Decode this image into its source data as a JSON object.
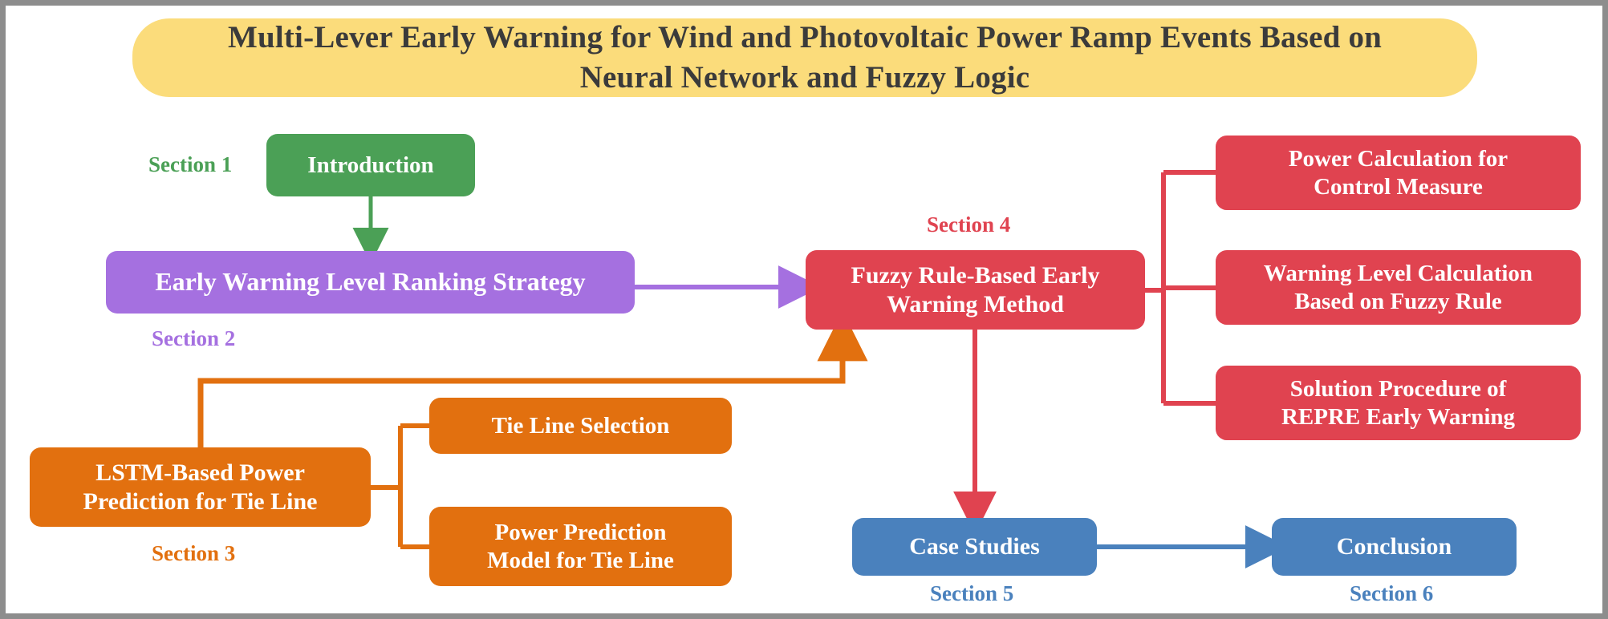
{
  "title": {
    "line1": "Multi-Lever Early Warning for Wind and Photovoltaic Power Ramp Events Based on",
    "line2": "Neural Network and Fuzzy Logic",
    "background": "#fbdc7b",
    "text_color": "#3b3b3b"
  },
  "nodes": {
    "introduction": {
      "label": "Introduction",
      "color": "#4ba056"
    },
    "early_warning_level_ranking_strategy": {
      "label": "Early Warning Level Ranking Strategy",
      "color": "#a570e0"
    },
    "lstm_based_power_prediction": {
      "line1": "LSTM-Based Power",
      "line2": "Prediction for Tie Line",
      "color": "#e2700f"
    },
    "tie_line_selection": {
      "label": "Tie Line Selection",
      "color": "#e2700f"
    },
    "power_prediction_model": {
      "line1": "Power Prediction",
      "line2": "Model for Tie Line",
      "color": "#e2700f"
    },
    "fuzzy_rule_based_early_warning_method": {
      "line1": "Fuzzy Rule-Based Early",
      "line2": "Warning Method",
      "color": "#e04350"
    },
    "power_calculation_for_control_measure": {
      "line1": "Power Calculation for",
      "line2": "Control Measure",
      "color": "#e04350"
    },
    "warning_level_calculation": {
      "line1": "Warning Level Calculation",
      "line2": "Based on Fuzzy Rule",
      "color": "#e04350"
    },
    "solution_procedure_repre": {
      "line1": "Solution Procedure of",
      "line2": "REPRE Early Warning",
      "color": "#e04350"
    },
    "case_studies": {
      "label": "Case Studies",
      "color": "#4a81bd"
    },
    "conclusion": {
      "label": "Conclusion",
      "color": "#4a81bd"
    }
  },
  "section_labels": {
    "section1": "Section 1",
    "section2": "Section 2",
    "section3": "Section 3",
    "section4": "Section 4",
    "section5": "Section 5",
    "section6": "Section 6"
  },
  "chart_data": {
    "type": "diagram",
    "title": "Multi-Lever Early Warning for Wind and Photovoltaic Power Ramp Events Based on Neural Network and Fuzzy Logic",
    "diagram_kind": "flowchart",
    "nodes": [
      {
        "id": "introduction",
        "label": "Introduction",
        "section": "Section 1",
        "color": "#4ba056"
      },
      {
        "id": "early_warning_level_ranking_strategy",
        "label": "Early Warning Level Ranking Strategy",
        "section": "Section 2",
        "color": "#a570e0"
      },
      {
        "id": "lstm_based_power_prediction",
        "label": "LSTM-Based Power Prediction for Tie Line",
        "section": "Section 3",
        "color": "#e2700f"
      },
      {
        "id": "tie_line_selection",
        "label": "Tie Line Selection",
        "section": "Section 3",
        "color": "#e2700f"
      },
      {
        "id": "power_prediction_model",
        "label": "Power Prediction Model for Tie Line",
        "section": "Section 3",
        "color": "#e2700f"
      },
      {
        "id": "fuzzy_rule_based_early_warning_method",
        "label": "Fuzzy Rule-Based Early Warning Method",
        "section": "Section 4",
        "color": "#e04350"
      },
      {
        "id": "power_calculation_for_control_measure",
        "label": "Power Calculation for Control Measure",
        "section": "Section 4",
        "color": "#e04350"
      },
      {
        "id": "warning_level_calculation",
        "label": "Warning Level Calculation Based on Fuzzy Rule",
        "section": "Section 4",
        "color": "#e04350"
      },
      {
        "id": "solution_procedure_repre",
        "label": "Solution Procedure of REPRE Early Warning",
        "section": "Section 4",
        "color": "#e04350"
      },
      {
        "id": "case_studies",
        "label": "Case Studies",
        "section": "Section 5",
        "color": "#4a81bd"
      },
      {
        "id": "conclusion",
        "label": "Conclusion",
        "section": "Section 6",
        "color": "#4a81bd"
      }
    ],
    "edges": [
      {
        "from": "introduction",
        "to": "early_warning_level_ranking_strategy",
        "style": "arrow",
        "color": "#4ba056"
      },
      {
        "from": "early_warning_level_ranking_strategy",
        "to": "fuzzy_rule_based_early_warning_method",
        "style": "arrow",
        "color": "#a570e0"
      },
      {
        "from": "lstm_based_power_prediction",
        "to": "fuzzy_rule_based_early_warning_method",
        "style": "elbow-arrow",
        "color": "#e2700f"
      },
      {
        "from": "lstm_based_power_prediction",
        "to": "tie_line_selection",
        "style": "bracket",
        "color": "#e2700f"
      },
      {
        "from": "lstm_based_power_prediction",
        "to": "power_prediction_model",
        "style": "bracket",
        "color": "#e2700f"
      },
      {
        "from": "fuzzy_rule_based_early_warning_method",
        "to": "power_calculation_for_control_measure",
        "style": "bracket",
        "color": "#e04350"
      },
      {
        "from": "fuzzy_rule_based_early_warning_method",
        "to": "warning_level_calculation",
        "style": "bracket",
        "color": "#e04350"
      },
      {
        "from": "fuzzy_rule_based_early_warning_method",
        "to": "solution_procedure_repre",
        "style": "bracket",
        "color": "#e04350"
      },
      {
        "from": "fuzzy_rule_based_early_warning_method",
        "to": "case_studies",
        "style": "arrow",
        "color": "#e04350"
      },
      {
        "from": "case_studies",
        "to": "conclusion",
        "style": "arrow",
        "color": "#4a81bd"
      }
    ]
  }
}
